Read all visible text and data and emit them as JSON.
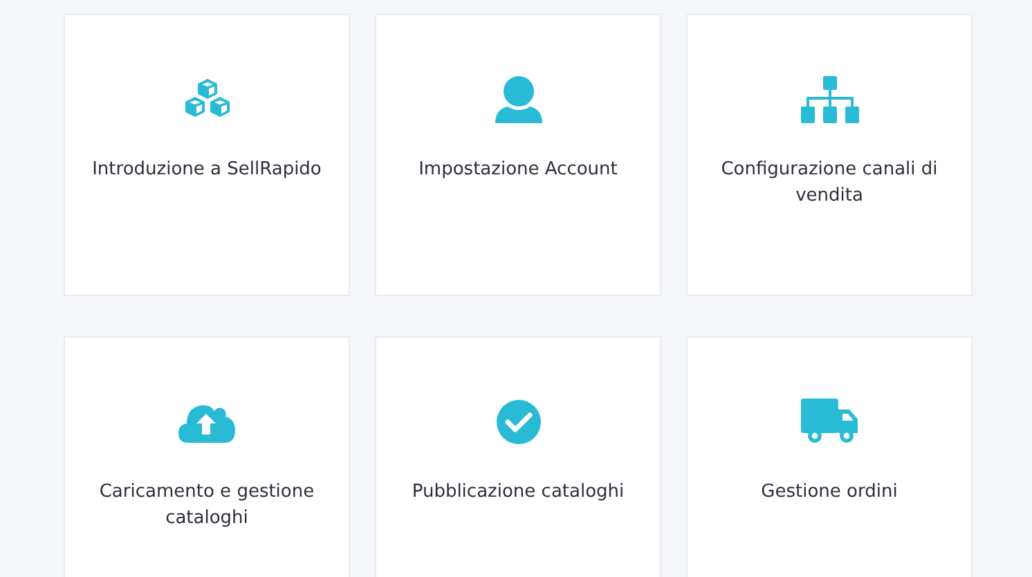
{
  "cards": [
    {
      "title": "Introduzione a SellRapido"
    },
    {
      "title": "Impostazione Account"
    },
    {
      "title": "Configurazione canali di vendita"
    },
    {
      "title": "Caricamento e gestione cataloghi"
    },
    {
      "title": "Pubblicazione cataloghi"
    },
    {
      "title": "Gestione ordini"
    }
  ]
}
